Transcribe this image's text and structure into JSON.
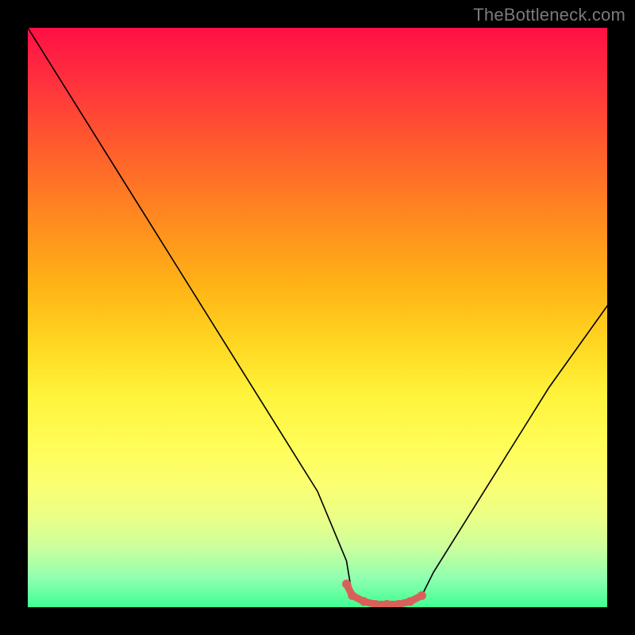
{
  "watermark": "TheBottleneck.com",
  "chart_data": {
    "type": "line",
    "title": "",
    "xlabel": "",
    "ylabel": "",
    "xlim": [
      0,
      100
    ],
    "ylim": [
      0,
      100
    ],
    "grid": false,
    "legend": false,
    "series": [
      {
        "name": "bottleneck-curve",
        "color": "#000000",
        "x": [
          0,
          5,
          10,
          15,
          20,
          25,
          30,
          35,
          40,
          45,
          50,
          55,
          56,
          58,
          60,
          62,
          64,
          66,
          68,
          70,
          75,
          80,
          85,
          90,
          95,
          100
        ],
        "y": [
          100,
          92,
          84,
          76,
          68,
          60,
          52,
          44,
          36,
          28,
          20,
          8,
          2,
          1,
          0.5,
          0.5,
          0.5,
          1,
          2,
          6,
          14,
          22,
          30,
          38,
          45,
          52
        ]
      },
      {
        "name": "optimal-range-marker",
        "color": "#d9605a",
        "x": [
          55,
          56,
          58,
          60,
          62,
          64,
          66,
          68
        ],
        "y": [
          4,
          2,
          1,
          0.5,
          0.5,
          0.5,
          1,
          2
        ]
      }
    ],
    "background_gradient_stops": [
      {
        "pos": 0,
        "color": "#ff0f45"
      },
      {
        "pos": 8,
        "color": "#ff2c3f"
      },
      {
        "pos": 20,
        "color": "#ff5a2e"
      },
      {
        "pos": 33,
        "color": "#ff8a1f"
      },
      {
        "pos": 45,
        "color": "#ffb516"
      },
      {
        "pos": 55,
        "color": "#ffd823"
      },
      {
        "pos": 63,
        "color": "#fff23a"
      },
      {
        "pos": 72,
        "color": "#fffd57"
      },
      {
        "pos": 79,
        "color": "#fbff72"
      },
      {
        "pos": 85,
        "color": "#e8ff88"
      },
      {
        "pos": 90,
        "color": "#c9ff9e"
      },
      {
        "pos": 95,
        "color": "#8fffaf"
      },
      {
        "pos": 100,
        "color": "#3fff93"
      }
    ]
  }
}
